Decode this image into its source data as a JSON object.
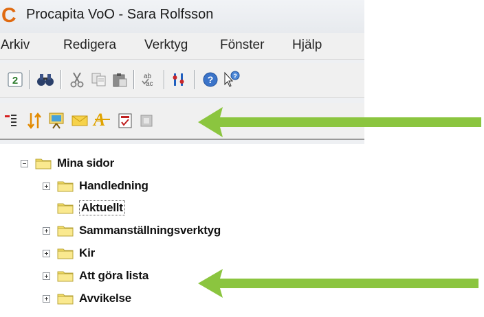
{
  "window": {
    "app_logo": "C",
    "title": "Procapita VoO - Sara Rolfsson"
  },
  "menu": {
    "items": [
      "Arkiv",
      "Redigera",
      "Verktyg",
      "Fönster",
      "Hjälp"
    ]
  },
  "toolbar": {
    "icons": [
      "refresh-icon",
      "binoculars-icon",
      "cut-icon",
      "copy-icon",
      "paste-icon",
      "spellcheck-icon",
      "filter-icon",
      "help-icon",
      "context-help-icon"
    ]
  },
  "toolbar2": {
    "icons": [
      "list-icon",
      "sort-icon",
      "presentation-icon",
      "mail-icon",
      "font-icon",
      "checklist-icon",
      "disabled-icon"
    ]
  },
  "tree": {
    "root": "Mina sidor",
    "items": [
      {
        "label": "Handledning",
        "expandable": true
      },
      {
        "label": "Aktuellt",
        "expandable": false
      },
      {
        "label": "Sammanställningsverktyg",
        "expandable": true
      },
      {
        "label": "Kir",
        "expandable": true
      },
      {
        "label": "Att göra lista",
        "expandable": true
      },
      {
        "label": "Avvikelse",
        "expandable": true
      }
    ]
  },
  "colors": {
    "arrow": "#8ac43f",
    "folder": "#f3de62",
    "logo": "#e06a10"
  }
}
